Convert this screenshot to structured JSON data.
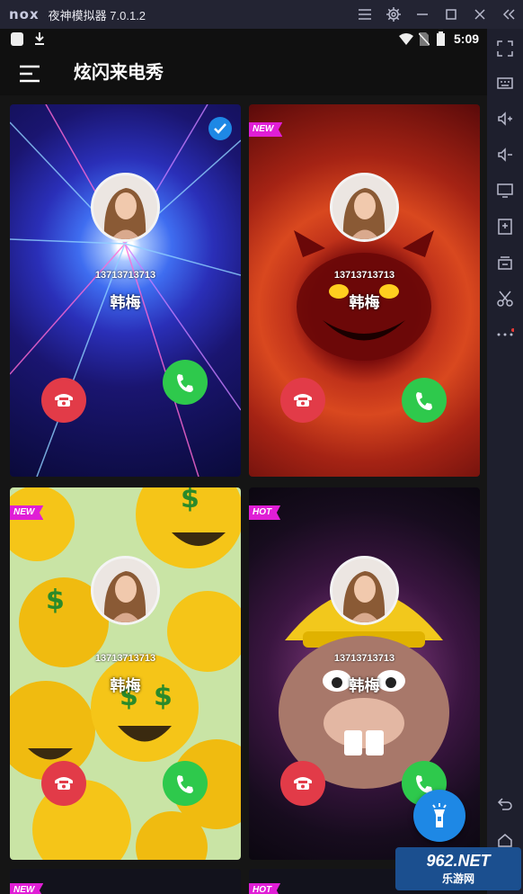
{
  "emulator": {
    "logo": "nox",
    "title": "夜神模拟器 7.0.1.2",
    "controls": [
      "menu-icon",
      "gear-icon",
      "minimize-icon",
      "maximize-icon",
      "close-icon",
      "collapse-icon"
    ]
  },
  "status_bar": {
    "time": "5:09"
  },
  "app": {
    "title": "炫闪来电秀"
  },
  "cards": [
    {
      "badge": "",
      "selected": true,
      "theme": "starburst",
      "number": "13713713713",
      "name": "韩梅"
    },
    {
      "badge": "NEW",
      "selected": false,
      "theme": "devil",
      "number": "13713713713",
      "name": "韩梅"
    },
    {
      "badge": "NEW",
      "selected": false,
      "theme": "emoji-dollar",
      "number": "13713713713",
      "name": "韩梅"
    },
    {
      "badge": "HOT",
      "selected": false,
      "theme": "beaver",
      "number": "13713713713",
      "name": "韩梅"
    },
    {
      "badge": "NEW",
      "selected": false,
      "theme": "dark",
      "number": "",
      "name": ""
    },
    {
      "badge": "HOT",
      "selected": false,
      "theme": "dark",
      "number": "",
      "name": ""
    }
  ],
  "watermark": {
    "brand": "962.NET",
    "sub": "乐游网"
  },
  "colors": {
    "accent": "#1e88e5",
    "badge": "#e01ed6",
    "decline": "#e23b48",
    "answer": "#2ec94c"
  }
}
